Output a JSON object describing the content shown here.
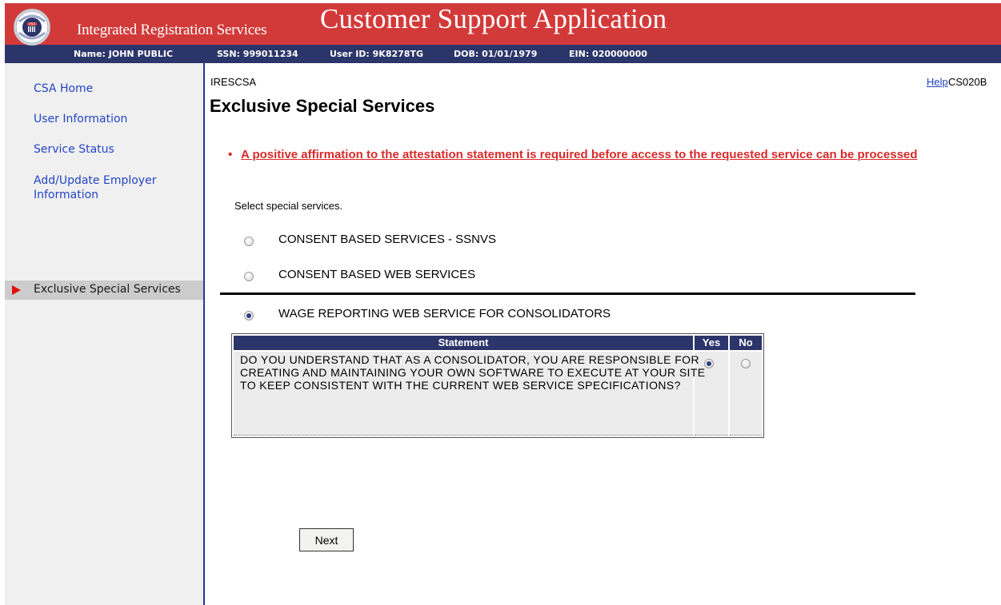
{
  "header": {
    "app_subtitle": "Integrated Registration Services",
    "app_title": "Customer Support Application",
    "logo_text_top": "SOCIAL SECURITY",
    "logo_text_bottom": "ADMINISTRATION",
    "logo_badge": "USA"
  },
  "user_bar": {
    "name": "Name: JOHN PUBLIC",
    "ssn": "SSN: 999011234",
    "user_id": "User ID: 9K8278TG",
    "dob": "DOB: 01/01/1979",
    "ein": "EIN: 020000000"
  },
  "sidebar": {
    "items": [
      {
        "label": "CSA Home"
      },
      {
        "label": "User Information"
      },
      {
        "label": "Service Status"
      },
      {
        "label": "Add/Update Employer Information"
      },
      {
        "label": "Exclusive Special Services",
        "active": true
      }
    ]
  },
  "main": {
    "page_id": "IRESCSA",
    "help_link": "Help",
    "screen_code": "CS020B",
    "title": "Exclusive Special Services",
    "error_message": "A positive affirmation to the attestation statement is required before access to the requested service can be processed",
    "select_label": "Select special services.",
    "options": [
      {
        "label": "CONSENT BASED SERVICES - SSNVS",
        "selected": false
      },
      {
        "label": "CONSENT BASED WEB SERVICES",
        "selected": false
      },
      {
        "label": "WAGE REPORTING WEB SERVICE FOR CONSOLIDATORS",
        "selected": true
      }
    ],
    "statement_table": {
      "headers": {
        "statement": "Statement",
        "yes": "Yes",
        "no": "No"
      },
      "rows": [
        {
          "text": "DO YOU UNDERSTAND THAT AS A CONSOLIDATOR, YOU ARE RESPONSIBLE FOR CREATING AND MAINTAINING YOUR OWN SOFTWARE TO EXECUTE AT YOUR SITE TO KEEP CONSISTENT WITH THE CURRENT WEB SERVICE SPECIFICATIONS?",
          "answer": "Yes"
        }
      ]
    },
    "next_button": "Next"
  },
  "colors": {
    "banner_red": "#d23a3a",
    "navy": "#2c3569",
    "error_red": "#d82a2a",
    "link_blue": "#2244c4"
  }
}
